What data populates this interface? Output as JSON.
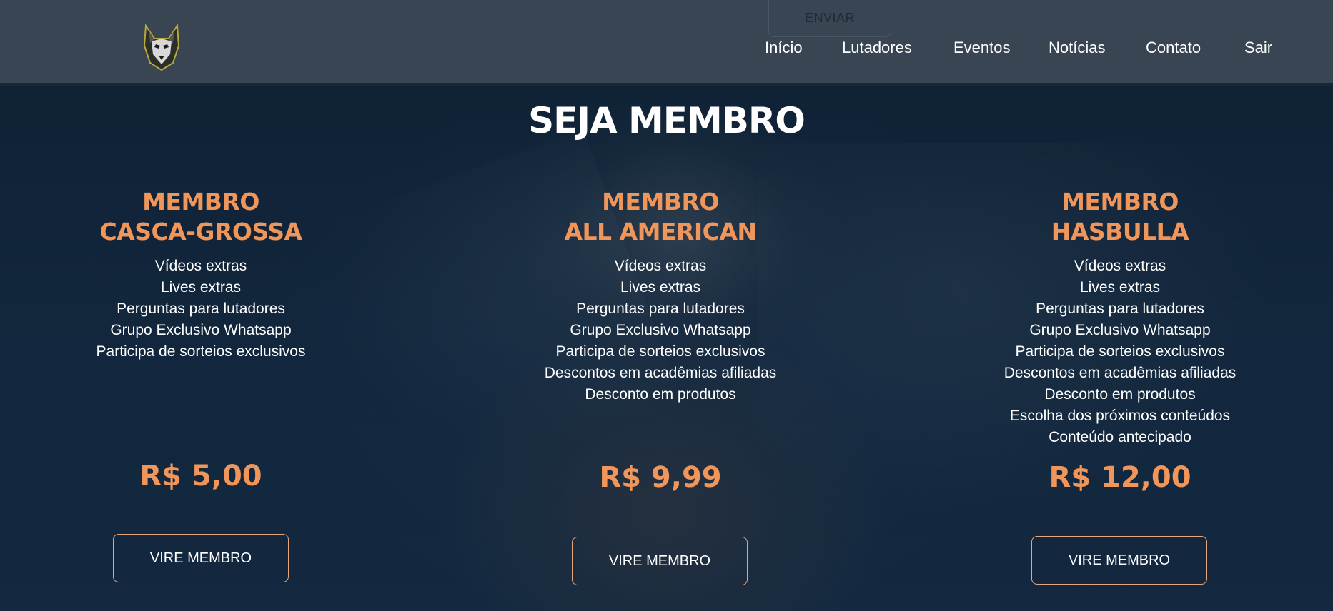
{
  "header": {
    "logo_icon": "wolf-logo-icon",
    "enviar_label": "ENVIAR",
    "nav": [
      {
        "label": "Início"
      },
      {
        "label": "Lutadores"
      },
      {
        "label": "Eventos"
      },
      {
        "label": "Notícias"
      },
      {
        "label": "Contato"
      },
      {
        "label": "Sair"
      }
    ]
  },
  "main": {
    "title": "SEJA MEMBRO",
    "plans": [
      {
        "name_line1": "MEMBRO",
        "name_line2": "CASCA-GROSSA",
        "features": [
          "Vídeos extras",
          "Lives extras",
          "Perguntas para lutadores",
          "Grupo Exclusivo Whatsapp",
          "Participa de sorteios exclusivos"
        ],
        "price": "R$ 5,00",
        "cta": "VIRE MEMBRO"
      },
      {
        "name_line1": "MEMBRO",
        "name_line2": "ALL AMERICAN",
        "features": [
          "Vídeos extras",
          "Lives extras",
          "Perguntas para lutadores",
          "Grupo Exclusivo Whatsapp",
          "Participa de sorteios exclusivos",
          "Descontos em acadêmias afiliadas",
          "Desconto em produtos"
        ],
        "price": "R$ 9,99",
        "cta": "VIRE MEMBRO"
      },
      {
        "name_line1": "MEMBRO",
        "name_line2": "HASBULLA",
        "features": [
          "Vídeos extras",
          "Lives extras",
          "Perguntas para lutadores",
          "Grupo Exclusivo Whatsapp",
          "Participa de sorteios exclusivos",
          "Descontos em acadêmias afiliadas",
          "Desconto em produtos",
          "Escolha dos próximos conteúdos",
          "Conteúdo antecipado"
        ],
        "price": "R$ 12,00",
        "cta": "VIRE MEMBRO"
      }
    ]
  },
  "colors": {
    "header_bg": "#394553",
    "accent": "#f0965a",
    "button_border": "#e7a679",
    "page_bg": "#15273b"
  }
}
